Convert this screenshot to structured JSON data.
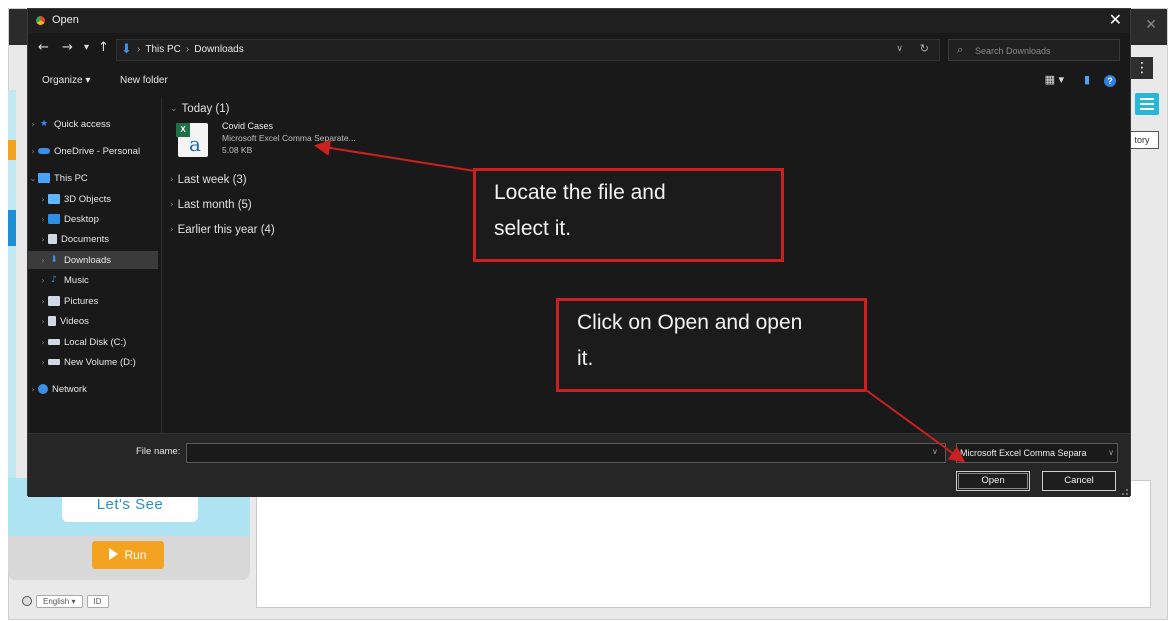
{
  "background_app": {
    "lets_see_label": "Let's See",
    "run_label": "Run",
    "tab_right_label": "tory",
    "language_label": "English",
    "lang_extra": "ID"
  },
  "dialog": {
    "title": "Open",
    "close_glyph": "✕",
    "nav": {
      "back": "←",
      "forward": "→",
      "recent": "▾",
      "up": "↑"
    },
    "breadcrumbs": [
      "This PC",
      "Downloads"
    ],
    "search_placeholder": "Search Downloads",
    "toolbar": {
      "organize": "Organize ▾",
      "new_folder": "New folder",
      "view_glyph": "▦ ▾",
      "pane_glyph": "▮",
      "help_glyph": "?"
    },
    "navpane": [
      {
        "label": "Quick access",
        "icon": "star-icon",
        "color": "#3b8fe8"
      },
      {
        "label": "OneDrive - Personal",
        "icon": "cloud-icon",
        "color": "#3b8fe8"
      },
      {
        "label": "This PC",
        "icon": "computer-icon",
        "color": "#4aa3ff"
      },
      {
        "label": "3D Objects",
        "icon": "cube-icon",
        "color": "#5fb6ff"
      },
      {
        "label": "Desktop",
        "icon": "desktop-icon",
        "color": "#2e8ee6"
      },
      {
        "label": "Documents",
        "icon": "document-icon",
        "color": "#cfd8e3"
      },
      {
        "label": "Downloads",
        "icon": "download-icon",
        "color": "#3b8fe8"
      },
      {
        "label": "Music",
        "icon": "music-icon",
        "color": "#3b8fe8"
      },
      {
        "label": "Pictures",
        "icon": "pictures-icon",
        "color": "#cfd8e3"
      },
      {
        "label": "Videos",
        "icon": "video-icon",
        "color": "#cfd8e3"
      },
      {
        "label": "Local Disk (C:)",
        "icon": "drive-icon",
        "color": "#cfd8e3"
      },
      {
        "label": "New Volume (D:)",
        "icon": "drive-icon",
        "color": "#cfd8e3"
      },
      {
        "label": "Network",
        "icon": "network-icon",
        "color": "#3b8fe8"
      }
    ],
    "groups": [
      {
        "label": "Today (1)"
      },
      {
        "label": "Last week (3)"
      },
      {
        "label": "Last month (5)"
      },
      {
        "label": "Earlier this year (4)"
      }
    ],
    "file": {
      "name": "Covid Cases",
      "type": "Microsoft Excel Comma Separate...",
      "size": "5.08 KB"
    },
    "file_name_label": "File name:",
    "file_name_value": "",
    "file_type_value": "Microsoft Excel Comma Separa",
    "open_label": "Open",
    "cancel_label": "Cancel"
  },
  "annotations": {
    "callout_1": [
      "Locate the file and",
      "select it."
    ],
    "callout_2": [
      "Click on Open and open",
      "it."
    ],
    "arrow_color": "#cc1f1f"
  }
}
